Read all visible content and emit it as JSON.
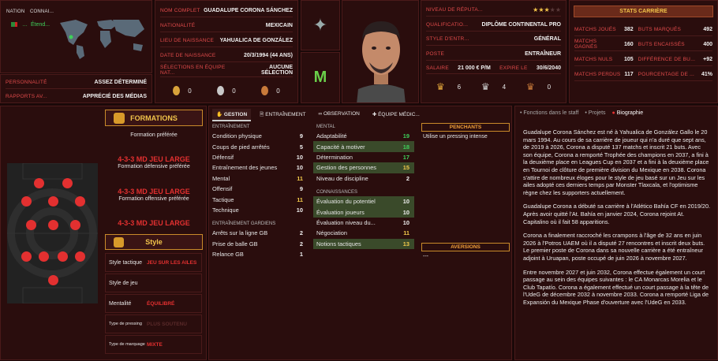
{
  "header": {
    "nation_label": "NATION",
    "nationality_label": "CONNAI...",
    "known_label": "Étend..."
  },
  "personal": {
    "personality_label": "PERSONNALITÉ",
    "personality_value": "ASSEZ DÉTERMINÉ",
    "reports_label": "RAPPORTS AV...",
    "reports_value": "APPRÉCIÉ DES MÉDIAS"
  },
  "info": {
    "rows": [
      {
        "label": "NOM COMPLET",
        "value": "GUADALUPE CORONA SÁNCHEZ"
      },
      {
        "label": "NATIONALITÉ",
        "value": "MEXICAIN"
      },
      {
        "label": "LIEU DE NAISSANCE",
        "value": "YAHUALICA DE GONZÁLEZ"
      },
      {
        "label": "DATE DE NAISSANCE",
        "value": "20/3/1994 (44 ANS)"
      },
      {
        "label": "SÉLECTIONS EN ÉQUIPE NAT...",
        "value": "AUCUNE SÉLECTION"
      }
    ],
    "medals": [
      "0",
      "0",
      "0"
    ]
  },
  "career": {
    "rows": [
      {
        "label": "NIVEAU DE RÉPUTA...",
        "value": ""
      },
      {
        "label": "QUALIFICATIO...",
        "value": "DIPLÔME CONTINENTAL PRO"
      },
      {
        "label": "STYLE D'ENTR...",
        "value": "GÉNÉRAL"
      },
      {
        "label": "POSTE",
        "value": "ENTRAÎNEUR"
      }
    ],
    "salary_label": "SALAIRE",
    "salary_value": "21 000 € P/M",
    "expire_label": "EXPIRE LE",
    "expire_value": "30/6/2040",
    "trophies": [
      "6",
      "4",
      "0"
    ],
    "stars": 3
  },
  "stats": {
    "title": "STATS CARRIÈRE",
    "left": [
      {
        "label": "MATCHS JOUÉS",
        "value": "382"
      },
      {
        "label": "MATCHS GAGNÉS",
        "value": "160"
      },
      {
        "label": "MATCHS NULS",
        "value": "105"
      },
      {
        "label": "MATCHS PERDUS",
        "value": "117"
      }
    ],
    "right": [
      {
        "label": "BUTS MARQUÉS",
        "value": "492"
      },
      {
        "label": "BUTS ENCAISSÉS",
        "value": "400"
      },
      {
        "label": "DIFFÉRENCE DE BU...",
        "value": "+92"
      },
      {
        "label": "POURCENTAGE DE ...",
        "value": "41%"
      }
    ]
  },
  "formations": {
    "title": "FORMATIONS",
    "pref_label": "Formation préférée",
    "f1": "4-3-3 MD JEU LARGE",
    "def_label": "Formation défensive préférée",
    "f2": "4-3-3 MD JEU LARGE",
    "off_label": "Formation offensive préférée",
    "f3": "4-3-3 MD JEU LARGE",
    "style_title": "Style",
    "tactic_label": "Style tactique",
    "tactic_value": "JEU SUR LES AILES",
    "play_label": "Style de jeu",
    "mental_label": "Mentalité",
    "mental_value": "ÉQUILIBRÉ",
    "press_label": "Type de pressing",
    "press_value": "PLUS SOUTENU",
    "mark_label": "Type de marquage",
    "mark_value": "MIXTE"
  },
  "tabs": [
    "GESTION",
    "ENTRAÎNEMENT",
    "OBSERVATION",
    "ÉQUIPE MÉDIC..."
  ],
  "attributes": {
    "training_head": "ENTRAÎNEMENT",
    "training": [
      {
        "n": "Condition physique",
        "v": "9"
      },
      {
        "n": "Coups de pied arrêtés",
        "v": "5"
      },
      {
        "n": "Défensif",
        "v": "10"
      },
      {
        "n": "Entraînement des jeunes",
        "v": "10"
      },
      {
        "n": "Mental",
        "v": "11"
      },
      {
        "n": "Offensif",
        "v": "9"
      },
      {
        "n": "Tactique",
        "v": "11"
      },
      {
        "n": "Technique",
        "v": "10"
      }
    ],
    "gk_head": "ENTRAÎNEMENT GARDIENS",
    "gk": [
      {
        "n": "Arrêts sur la ligne GB",
        "v": "2"
      },
      {
        "n": "Prise de balle GB",
        "v": "2"
      },
      {
        "n": "Relance GB",
        "v": "1"
      }
    ],
    "mental_head": "MENTAL",
    "mental": [
      {
        "n": "Adaptabilité",
        "v": "19"
      },
      {
        "n": "Capacité à motiver",
        "v": "18"
      },
      {
        "n": "Détermination",
        "v": "17"
      },
      {
        "n": "Gestion des personnes",
        "v": "15"
      },
      {
        "n": "Niveau de discipline",
        "v": "2"
      }
    ],
    "know_head": "CONNAISSANCES",
    "know": [
      {
        "n": "Évaluation du potentiel",
        "v": "10"
      },
      {
        "n": "Évaluation joueurs",
        "v": "10"
      },
      {
        "n": "Évaluation niveau du...",
        "v": "10"
      },
      {
        "n": "Négociation",
        "v": "11"
      },
      {
        "n": "Notions tactiques",
        "v": "13"
      }
    ]
  },
  "tendencies": {
    "title": "PENCHANTS",
    "value": "Utilise un pressing intense",
    "aversions_title": "AVERSIONS",
    "aversions_value": "---"
  },
  "bio": {
    "tabs": [
      "Fonctions dans le staff",
      "Projets",
      "Biographie"
    ],
    "p1": "Guadalupe Corona Sánchez est né à Yahualica de González Gallo le 20 mars 1994. Au cours de sa carrière de joueur qui n'a duré que sept ans, de 2019 à 2026, Corona a disputé 137 matchs et inscrit 21 buts. Avec son équipe, Corona a remporté Trophée des champions en 2037, a fini à la deuxième place en Leagues Cup en 2037 et a fini à la deuxième place en Tournoi de clôture de première division du Mexique en 2038. Corona s'attire de nombreux éloges pour le style de jeu basé sur un Jeu sur les ailes adopté ces derniers temps par Monster Tlaxcala, et l'optimisme règne chez les supporters actuellement.",
    "p2": "Guadalupe Corona a débuté sa carrière à l'Atlético Bahía CF en 2019/20. Après avoir quitté l'At. Bahía en janvier 2024, Corona rejoint At. Capitalino où il fait 58 apparitions.",
    "p3": "Corona a finalement raccroché les crampons à l'âge de 32 ans en juin 2026 à l'Potros UAEM où il a disputé 27 rencontres et inscrit deux buts. Le premier poste de Corona dans sa nouvelle carrière a été entraîneur adjoint à Uruapan, poste occupé de juin 2026 à novembre 2027.",
    "p4": "Entre novembre 2027 et juin 2032, Corona effectue également un court passage au sein des équipes suivantes : le CA Monarcas Morelia et le Club Tapatío. Corona a également effectué un court passage à la tête de l'UdeG de décembre 2032 à novembre 2033. Corona a remporté Liga de Expansión du Mexique Phase d'ouverture avec l'UdeG en 2033."
  },
  "colors": {
    "accent": "#e23a3a",
    "gold": "#f2c44a",
    "green": "#3fd05a",
    "bg": "#2a0d0d"
  }
}
